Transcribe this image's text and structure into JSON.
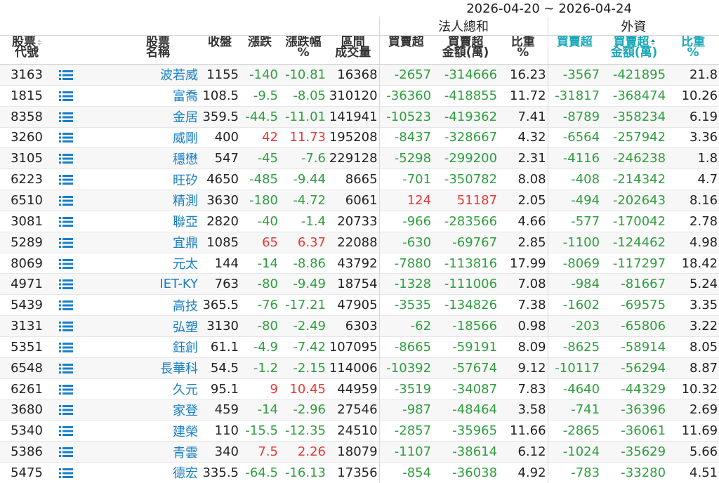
{
  "date_range": "2026-04-20 ~ 2026-04-24",
  "groups": {
    "institutional": "法人總和",
    "foreign": "外資"
  },
  "headers": {
    "code": [
      "股票",
      "代號"
    ],
    "name": [
      "股票",
      "名稱"
    ],
    "close": "收盤",
    "change": "漲跌",
    "pct": [
      "漲跌幅",
      "%"
    ],
    "volume": [
      "區間",
      "成交量"
    ],
    "inst_net": "買賣超",
    "inst_amt": [
      "買賣超",
      "金額(萬)"
    ],
    "inst_ratio": [
      "比重",
      "%"
    ],
    "fx_net": "買賣超",
    "fx_amt": [
      "買賣超",
      "金額(萬)"
    ],
    "fx_ratio": [
      "比重",
      "%"
    ]
  },
  "colors": {
    "negative": "#2e9e3e",
    "positive": "#e53935",
    "link": "#1a7fc7",
    "foreign_header": "#19a8b8"
  },
  "rows": [
    {
      "code": "3163",
      "name": "波若威",
      "close": "1155",
      "change": "-140",
      "pct": "-10.81",
      "volume": "16368",
      "inst_net": "-2657",
      "inst_amt": "-314666",
      "inst_ratio": "16.23",
      "fx_net": "-3567",
      "fx_amt": "-421895",
      "fx_ratio": "21.8"
    },
    {
      "code": "1815",
      "name": "富喬",
      "close": "108.5",
      "change": "-9.5",
      "pct": "-8.05",
      "volume": "310120",
      "inst_net": "-36360",
      "inst_amt": "-418855",
      "inst_ratio": "11.72",
      "fx_net": "-31817",
      "fx_amt": "-368474",
      "fx_ratio": "10.26"
    },
    {
      "code": "8358",
      "name": "金居",
      "close": "359.5",
      "change": "-44.5",
      "pct": "-11.01",
      "volume": "141941",
      "inst_net": "-10523",
      "inst_amt": "-419362",
      "inst_ratio": "7.41",
      "fx_net": "-8789",
      "fx_amt": "-358234",
      "fx_ratio": "6.19"
    },
    {
      "code": "3260",
      "name": "威剛",
      "close": "400",
      "change": "42",
      "pct": "11.73",
      "volume": "195208",
      "inst_net": "-8437",
      "inst_amt": "-328667",
      "inst_ratio": "4.32",
      "fx_net": "-6564",
      "fx_amt": "-257942",
      "fx_ratio": "3.36"
    },
    {
      "code": "3105",
      "name": "穩懋",
      "close": "547",
      "change": "-45",
      "pct": "-7.6",
      "volume": "229128",
      "inst_net": "-5298",
      "inst_amt": "-299200",
      "inst_ratio": "2.31",
      "fx_net": "-4116",
      "fx_amt": "-246238",
      "fx_ratio": "1.8"
    },
    {
      "code": "6223",
      "name": "旺矽",
      "close": "4650",
      "change": "-485",
      "pct": "-9.44",
      "volume": "8665",
      "inst_net": "-701",
      "inst_amt": "-350782",
      "inst_ratio": "8.08",
      "fx_net": "-408",
      "fx_amt": "-214342",
      "fx_ratio": "4.7"
    },
    {
      "code": "6510",
      "name": "精測",
      "close": "3630",
      "change": "-180",
      "pct": "-4.72",
      "volume": "6061",
      "inst_net": "124",
      "inst_amt": "51187",
      "inst_ratio": "2.05",
      "fx_net": "-494",
      "fx_amt": "-202643",
      "fx_ratio": "8.16"
    },
    {
      "code": "3081",
      "name": "聯亞",
      "close": "2820",
      "change": "-40",
      "pct": "-1.4",
      "volume": "20733",
      "inst_net": "-966",
      "inst_amt": "-283566",
      "inst_ratio": "4.66",
      "fx_net": "-577",
      "fx_amt": "-170042",
      "fx_ratio": "2.78"
    },
    {
      "code": "5289",
      "name": "宜鼎",
      "close": "1085",
      "change": "65",
      "pct": "6.37",
      "volume": "22088",
      "inst_net": "-630",
      "inst_amt": "-69767",
      "inst_ratio": "2.85",
      "fx_net": "-1100",
      "fx_amt": "-124462",
      "fx_ratio": "4.98"
    },
    {
      "code": "8069",
      "name": "元太",
      "close": "144",
      "change": "-14",
      "pct": "-8.86",
      "volume": "43792",
      "inst_net": "-7880",
      "inst_amt": "-113816",
      "inst_ratio": "17.99",
      "fx_net": "-8069",
      "fx_amt": "-117297",
      "fx_ratio": "18.42"
    },
    {
      "code": "4971",
      "name": "IET-KY",
      "close": "763",
      "change": "-80",
      "pct": "-9.49",
      "volume": "18754",
      "inst_net": "-1328",
      "inst_amt": "-111006",
      "inst_ratio": "7.08",
      "fx_net": "-984",
      "fx_amt": "-81667",
      "fx_ratio": "5.24"
    },
    {
      "code": "5439",
      "name": "高技",
      "close": "365.5",
      "change": "-76",
      "pct": "-17.21",
      "volume": "47905",
      "inst_net": "-3535",
      "inst_amt": "-134826",
      "inst_ratio": "7.38",
      "fx_net": "-1602",
      "fx_amt": "-69575",
      "fx_ratio": "3.35"
    },
    {
      "code": "3131",
      "name": "弘塑",
      "close": "3130",
      "change": "-80",
      "pct": "-2.49",
      "volume": "6303",
      "inst_net": "-62",
      "inst_amt": "-18566",
      "inst_ratio": "0.98",
      "fx_net": "-203",
      "fx_amt": "-65806",
      "fx_ratio": "3.22"
    },
    {
      "code": "5351",
      "name": "鈺創",
      "close": "61.1",
      "change": "-4.9",
      "pct": "-7.42",
      "volume": "107095",
      "inst_net": "-8665",
      "inst_amt": "-59191",
      "inst_ratio": "8.09",
      "fx_net": "-8625",
      "fx_amt": "-58914",
      "fx_ratio": "8.05"
    },
    {
      "code": "6548",
      "name": "長華科",
      "close": "54.5",
      "change": "-1.2",
      "pct": "-2.15",
      "volume": "114006",
      "inst_net": "-10392",
      "inst_amt": "-57674",
      "inst_ratio": "9.12",
      "fx_net": "-10117",
      "fx_amt": "-56294",
      "fx_ratio": "8.87"
    },
    {
      "code": "6261",
      "name": "久元",
      "close": "95.1",
      "change": "9",
      "pct": "10.45",
      "volume": "44959",
      "inst_net": "-3519",
      "inst_amt": "-34087",
      "inst_ratio": "7.83",
      "fx_net": "-4640",
      "fx_amt": "-44329",
      "fx_ratio": "10.32"
    },
    {
      "code": "3680",
      "name": "家登",
      "close": "459",
      "change": "-14",
      "pct": "-2.96",
      "volume": "27546",
      "inst_net": "-987",
      "inst_amt": "-48464",
      "inst_ratio": "3.58",
      "fx_net": "-741",
      "fx_amt": "-36396",
      "fx_ratio": "2.69"
    },
    {
      "code": "5340",
      "name": "建榮",
      "close": "110",
      "change": "-15.5",
      "pct": "-12.35",
      "volume": "24510",
      "inst_net": "-2857",
      "inst_amt": "-35965",
      "inst_ratio": "11.66",
      "fx_net": "-2865",
      "fx_amt": "-36061",
      "fx_ratio": "11.69"
    },
    {
      "code": "5386",
      "name": "青雲",
      "close": "340",
      "change": "7.5",
      "pct": "2.26",
      "volume": "18079",
      "inst_net": "-1107",
      "inst_amt": "-38614",
      "inst_ratio": "6.12",
      "fx_net": "-1024",
      "fx_amt": "-35629",
      "fx_ratio": "5.66"
    },
    {
      "code": "5475",
      "name": "德宏",
      "close": "335.5",
      "change": "-64.5",
      "pct": "-16.13",
      "volume": "17356",
      "inst_net": "-854",
      "inst_amt": "-36038",
      "inst_ratio": "4.92",
      "fx_net": "-783",
      "fx_amt": "-33280",
      "fx_ratio": "4.51"
    }
  ]
}
